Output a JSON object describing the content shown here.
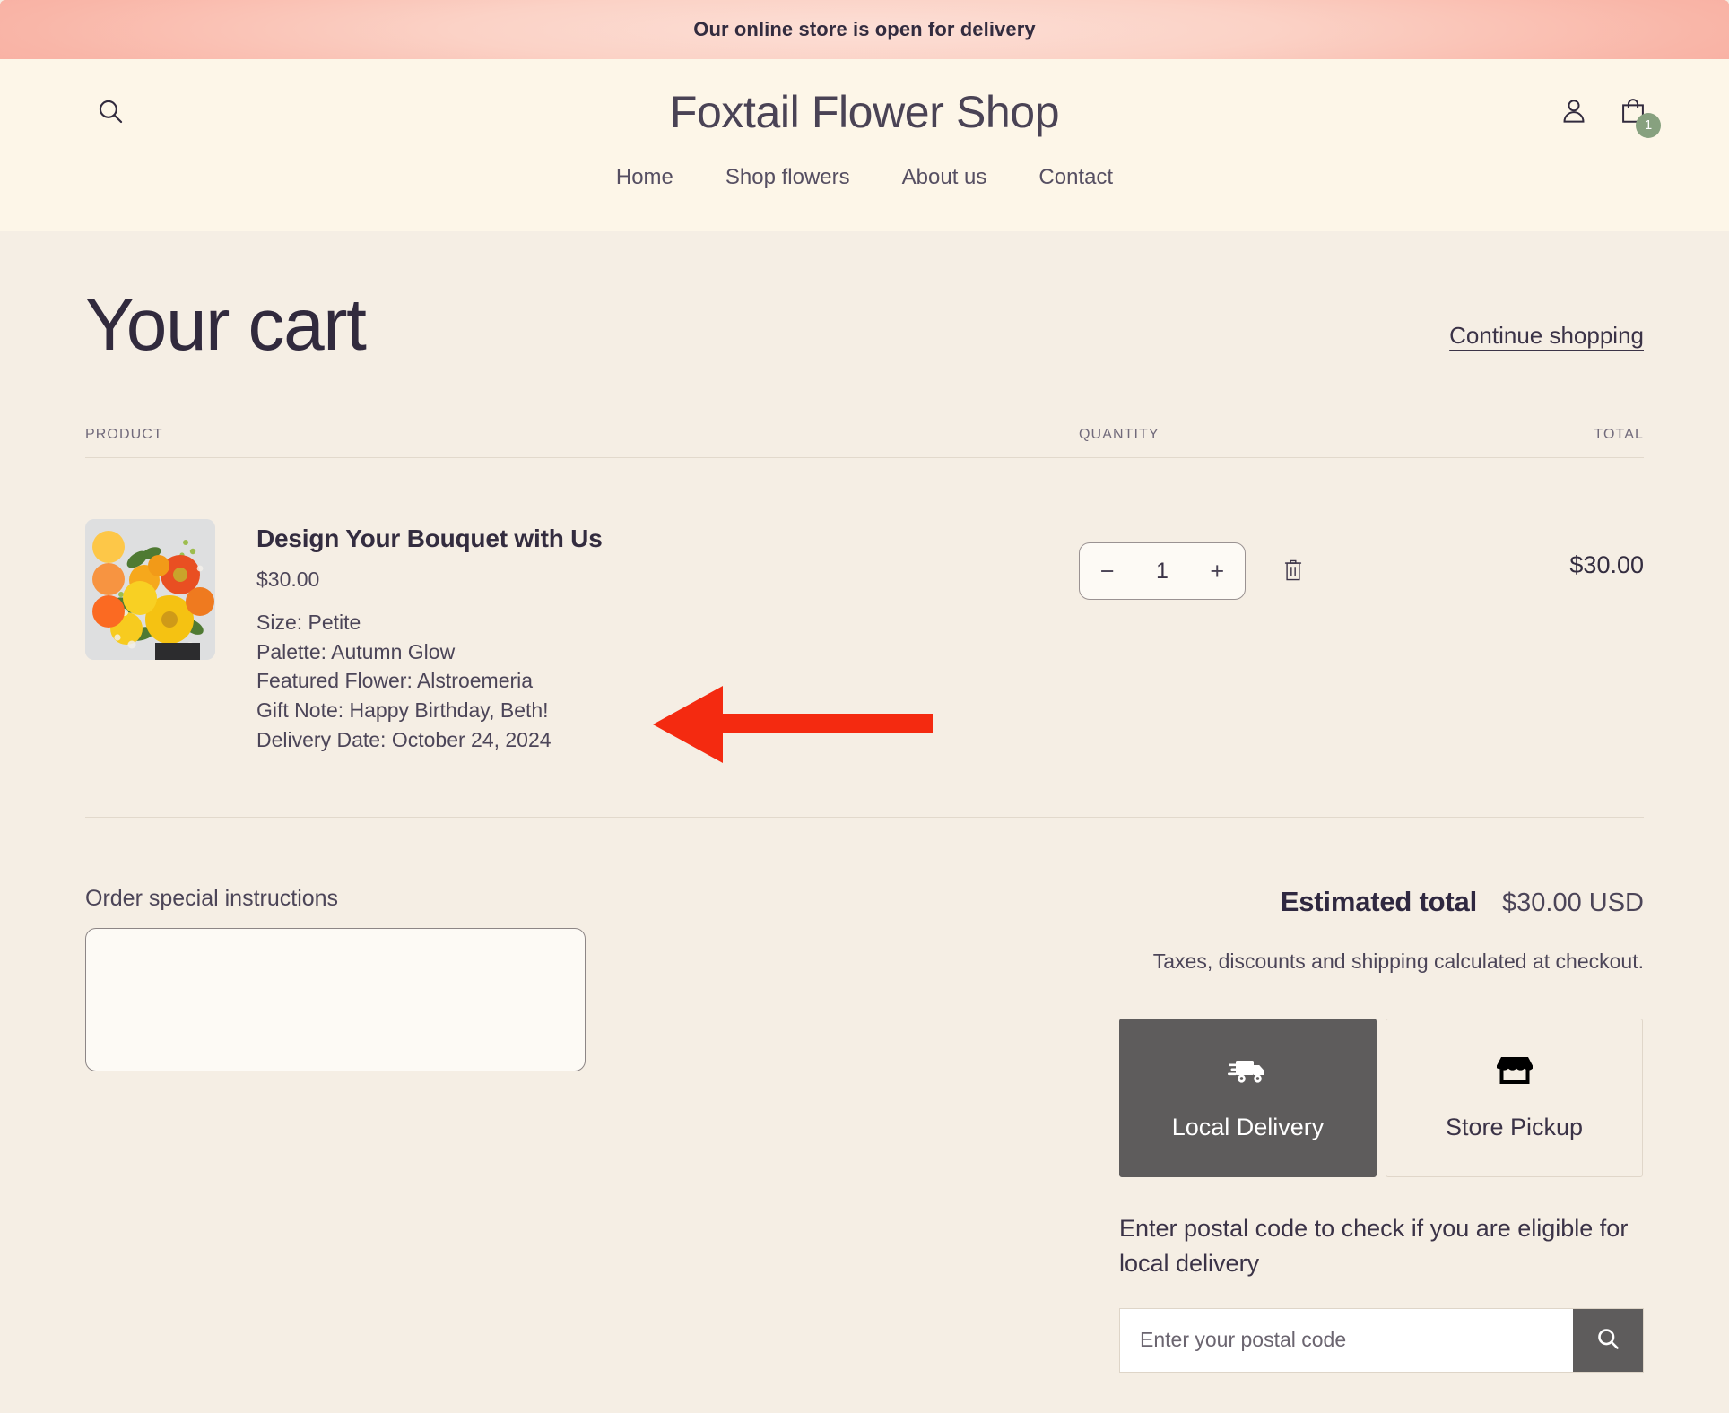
{
  "announcement": {
    "text": "Our online store is open for delivery",
    "gradient_from": "#f8ab9e",
    "gradient_to": "#fcdfd6"
  },
  "header": {
    "shop_title": "Foxtail Flower Shop",
    "search_icon": "search-icon",
    "account_icon": "user-icon",
    "cart_icon": "shopping-bag-icon",
    "cart_count": "1",
    "cart_badge_color": "#87a17f",
    "background": "#fdf6e8"
  },
  "nav": {
    "items": [
      {
        "label": "Home"
      },
      {
        "label": "Shop flowers"
      },
      {
        "label": "About us"
      },
      {
        "label": "Contact"
      }
    ]
  },
  "cart": {
    "title": "Your cart",
    "continue_shopping": "Continue shopping",
    "columns": {
      "product": "PRODUCT",
      "quantity": "QUANTITY",
      "total": "TOTAL"
    },
    "items": [
      {
        "title": "Design Your Bouquet with Us",
        "price": "$30.00",
        "properties": [
          "Size: Petite",
          "Palette: Autumn Glow",
          "Featured Flower: Alstroemeria",
          "Gift Note: Happy Birthday, Beth!",
          "Delivery Date: October 24, 2024"
        ],
        "quantity": "1",
        "decrease_label": "−",
        "increase_label": "+",
        "remove_icon": "trash-icon",
        "line_total": "$30.00",
        "thumbnail": {
          "alt": "bouquet-of-yellow-and-orange-flowers",
          "swatches": [
            "#fdc748",
            "#f79441",
            "#fb6a22"
          ]
        }
      }
    ]
  },
  "instructions": {
    "label": "Order special instructions",
    "value": "",
    "placeholder": ""
  },
  "summary": {
    "estimated_total_label": "Estimated total",
    "estimated_total_value": "$30.00 USD",
    "tax_note": "Taxes, discounts and shipping calculated at checkout."
  },
  "fulfillment": {
    "options": [
      {
        "label": "Local Delivery",
        "icon": "delivery-truck-icon",
        "selected": true
      },
      {
        "label": "Store Pickup",
        "icon": "storefront-icon",
        "selected": false
      }
    ],
    "postal_prompt": "Enter postal code to check if you are eligible for local delivery",
    "postal_placeholder": "Enter your postal code",
    "postal_value": "",
    "postal_search_icon": "search-icon"
  },
  "annotation": {
    "arrow_color": "#f42a10",
    "points_at": "Gift Note: Happy Birthday, Beth!"
  }
}
